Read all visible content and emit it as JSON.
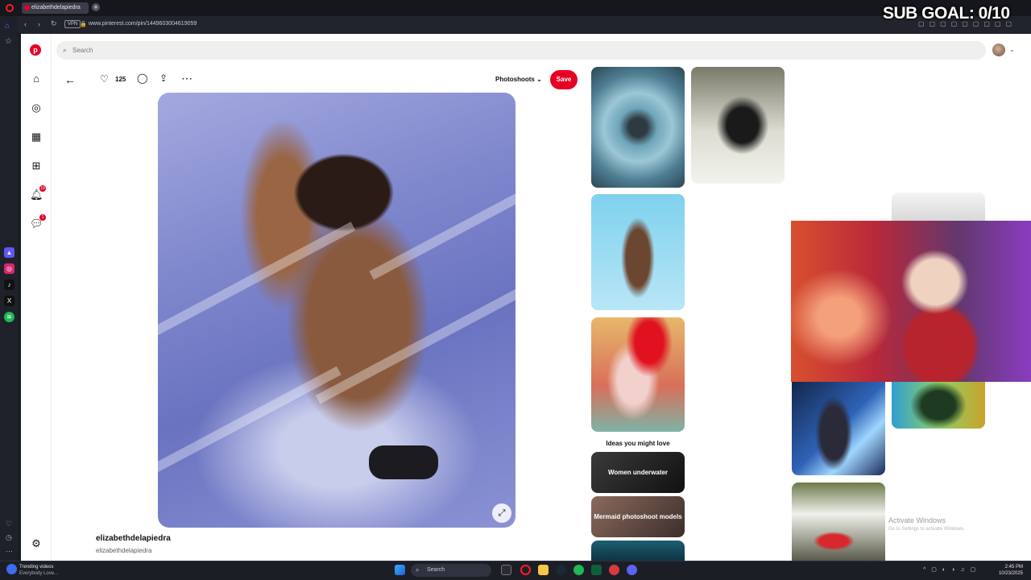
{
  "browser": {
    "tab_title": "elizabethdelapiedra",
    "new_tab": "+",
    "vpn_label": "VPN",
    "url": "www.pinterest.com/pin/1449603004619059"
  },
  "stream_overlay": {
    "sub_goal": "SUB GOAL: 0/10"
  },
  "pinterest": {
    "search_placeholder": "Search",
    "notifications_badge": "10",
    "messages_badge": "1",
    "pin": {
      "like_count": "125",
      "board": "Photoshoots",
      "save_label": "Save",
      "author_name": "elizabethdelapiedra",
      "author_handle": "elizabethdelapiedra"
    },
    "ideas_title": "Ideas you might love",
    "ideas": [
      {
        "label": "Women underwater"
      },
      {
        "label": "Mermaid photoshoot models"
      }
    ]
  },
  "windows": {
    "activate_title": "Activate Windows",
    "activate_sub": "Go to Settings to activate Windows.",
    "taskbar_search": "Search",
    "news_title": "Trending videos",
    "news_sub": "Everybody Love...",
    "time": "2:45 PM",
    "date": "10/23/2025"
  },
  "colors": {
    "pinterest_red": "#e60023",
    "browser_dark": "#1b1d24"
  }
}
